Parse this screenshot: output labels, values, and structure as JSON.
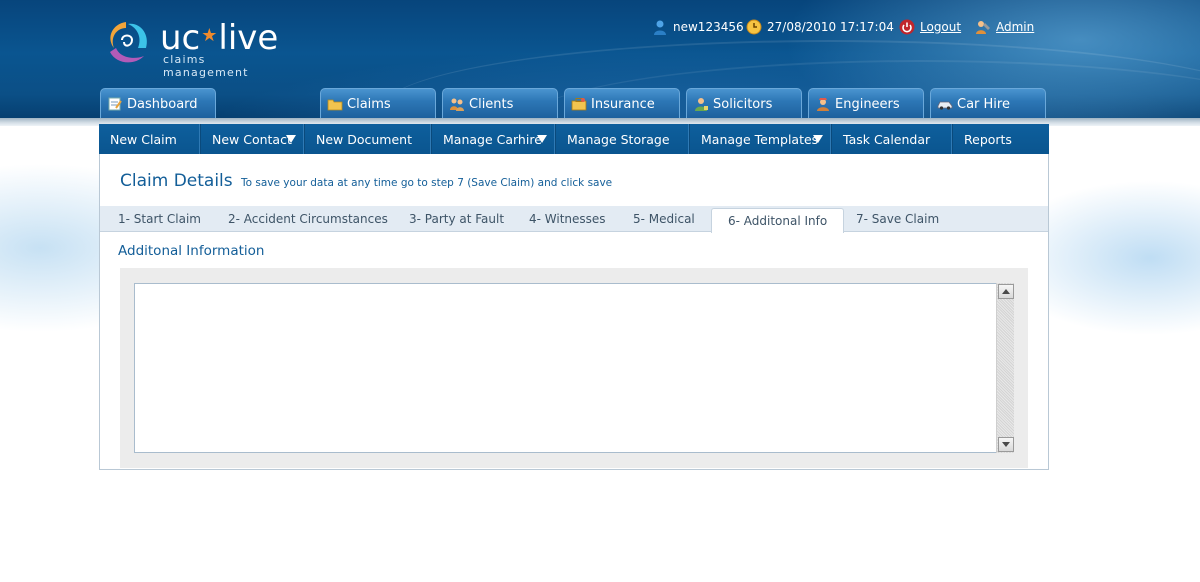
{
  "app": {
    "logo_text_left": "uc",
    "logo_text_right": "live",
    "logo_tagline": "claims management"
  },
  "userbar": {
    "username": "new123456",
    "datetime": "27/08/2010 17:17:04",
    "logout_label": "Logout",
    "admin_label": "Admin"
  },
  "main_tabs": [
    {
      "label": "Dashboard",
      "icon": "notepad-icon"
    },
    {
      "label": "Claims",
      "icon": "folder-icon"
    },
    {
      "label": "Clients",
      "icon": "people-icon"
    },
    {
      "label": "Insurance",
      "icon": "briefcase-icon"
    },
    {
      "label": "Solicitors",
      "icon": "solicitor-icon"
    },
    {
      "label": "Engineers",
      "icon": "engineer-icon"
    },
    {
      "label": "Car Hire",
      "icon": "car-icon"
    }
  ],
  "subnav": [
    {
      "label": "New Claim",
      "dropdown": false
    },
    {
      "label": "New Contact",
      "dropdown": true
    },
    {
      "label": "New Document",
      "dropdown": false
    },
    {
      "label": "Manage Carhire",
      "dropdown": true
    },
    {
      "label": "Manage Storage",
      "dropdown": false
    },
    {
      "label": "Manage Templates",
      "dropdown": true
    },
    {
      "label": "Task Calendar",
      "dropdown": false
    },
    {
      "label": "Reports",
      "dropdown": false
    }
  ],
  "page": {
    "title": "Claim Details",
    "hint": "To save your data at any time go to step 7 (Save Claim) and click save",
    "section_title": "Additonal Information",
    "textarea_value": ""
  },
  "steps": [
    {
      "label": "1- Start Claim"
    },
    {
      "label": "2- Accident Circumstances"
    },
    {
      "label": "3- Party at Fault"
    },
    {
      "label": "4- Witnesses"
    },
    {
      "label": "5- Medical"
    },
    {
      "label": "6- Additonal Info",
      "active": true
    },
    {
      "label": "7- Save Claim"
    }
  ],
  "colors": {
    "header_blue": "#0a5590",
    "nav_blue": "#0a558f",
    "title_blue": "#135e98",
    "accent_orange": "#f08a2c"
  }
}
